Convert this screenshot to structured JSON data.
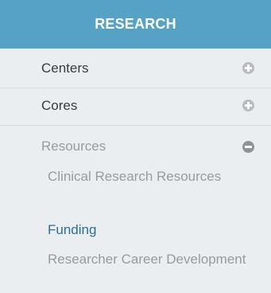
{
  "header": {
    "title": "RESEARCH"
  },
  "menu": {
    "items": [
      {
        "label": "Centers",
        "icon": "plus-circle-icon",
        "expanded": false
      },
      {
        "label": "Cores",
        "icon": "plus-circle-icon",
        "expanded": false
      },
      {
        "label": "Resources",
        "icon": "minus-circle-icon",
        "expanded": true
      }
    ],
    "subitems": [
      {
        "label": "Clinical Research Resources",
        "active": false
      },
      {
        "label": "Funding",
        "active": true
      },
      {
        "label": "Researcher Career Development",
        "active": false
      }
    ]
  },
  "colors": {
    "header_bg": "#56a1c6",
    "panel_bg": "#ebeef0",
    "active_link": "#2e6e96",
    "muted_text": "#9a9a9a"
  }
}
